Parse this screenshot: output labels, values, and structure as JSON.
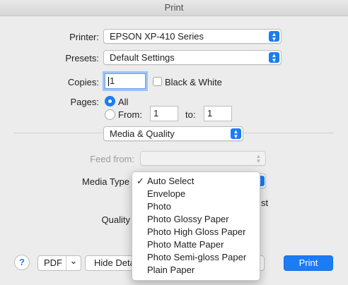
{
  "window": {
    "title": "Print"
  },
  "printer": {
    "label": "Printer:",
    "value": "EPSON XP-410 Series"
  },
  "presets": {
    "label": "Presets:",
    "value": "Default Settings"
  },
  "copies": {
    "label": "Copies:",
    "value": "1",
    "black_white_label": "Black & White"
  },
  "pages": {
    "label": "Pages:",
    "all_label": "All",
    "from_label": "From:",
    "from_value": "1",
    "to_label": "to:",
    "to_value": "1"
  },
  "section": {
    "value": "Media & Quality"
  },
  "feed": {
    "label": "Feed from:",
    "value": ""
  },
  "media_type": {
    "label": "Media Type",
    "options": [
      {
        "label": "Auto Select",
        "selected": true,
        "check": "✓"
      },
      {
        "label": "Envelope"
      },
      {
        "label": "Photo"
      },
      {
        "label": "Photo Glossy Paper"
      },
      {
        "label": "Photo High Gloss Paper"
      },
      {
        "label": "Photo Matte Paper"
      },
      {
        "label": "Photo Semi-gloss Paper"
      },
      {
        "label": "Plain Paper"
      }
    ]
  },
  "quality": {
    "label": "Quality",
    "partial_right": "st"
  },
  "footer": {
    "help": "?",
    "pdf": "PDF",
    "pdf_arrow": "⌄",
    "hide_details": "Hide Details",
    "print": "Print"
  }
}
